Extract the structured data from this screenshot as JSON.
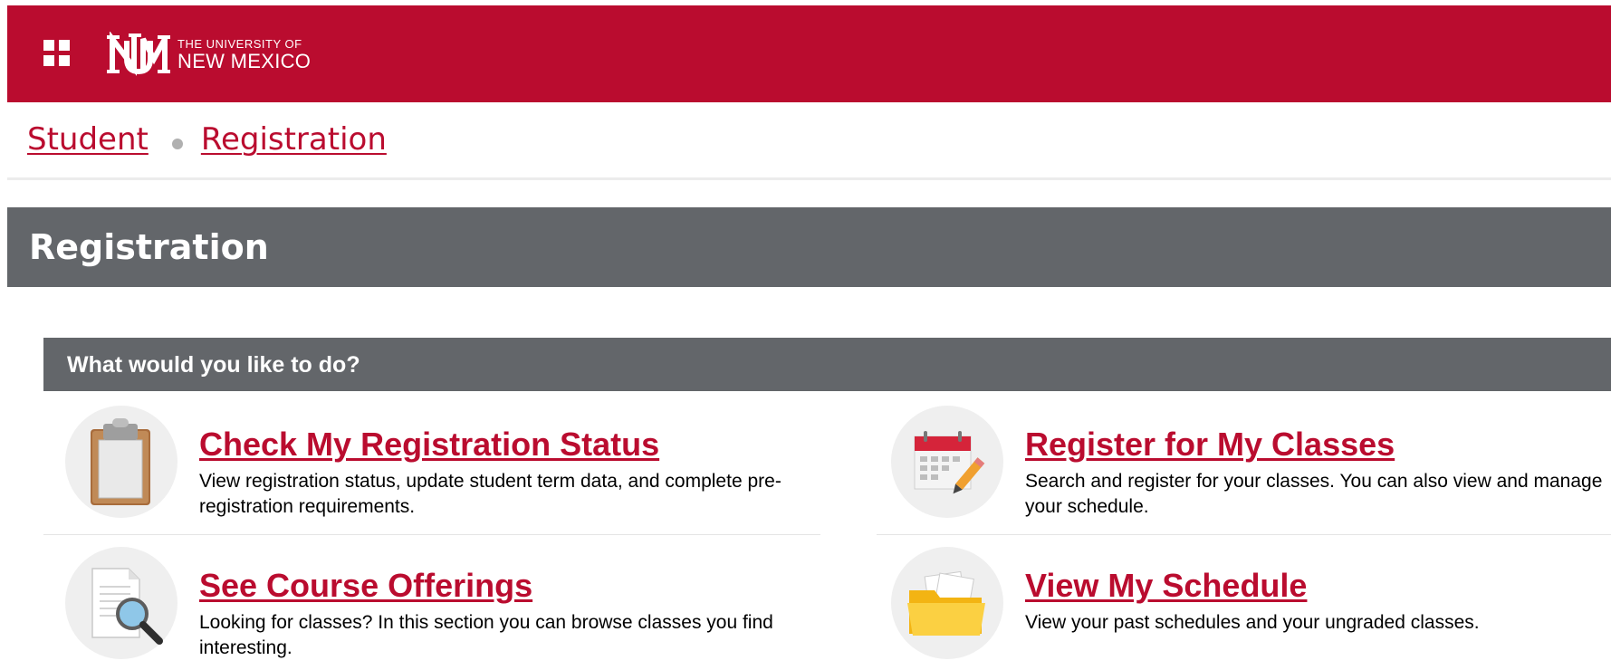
{
  "header": {
    "logo_line1": "THE UNIVERSITY OF",
    "logo_line2": "NEW MEXICO",
    "brand_color": "#ba0c2f"
  },
  "breadcrumb": {
    "items": [
      "Student",
      "Registration"
    ]
  },
  "page": {
    "title": "Registration",
    "section_title": "What would you like to do?",
    "band_color": "#63666a"
  },
  "options": [
    {
      "title": "Check My Registration Status",
      "description": "View registration status, update student term data, and complete pre-registration requirements.",
      "icon": "clipboard-icon"
    },
    {
      "title": "Register for My Classes",
      "description": "Search and register for your classes. You can also view and manage your schedule.",
      "icon": "calendar-icon"
    },
    {
      "title": "See Course Offerings",
      "description": "Looking for classes? In this section you can browse classes you find interesting.",
      "icon": "magnifier-document-icon"
    },
    {
      "title": "View My Schedule",
      "description": "View your past schedules and your ungraded classes.",
      "icon": "folder-icon"
    }
  ]
}
